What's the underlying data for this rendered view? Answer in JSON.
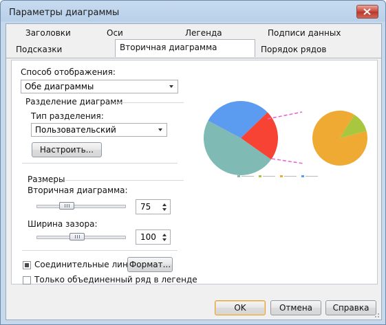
{
  "window": {
    "title": "Параметры диаграммы"
  },
  "tabs_row1": [
    "Заголовки",
    "Оси",
    "Легенда",
    "Подписи данных"
  ],
  "tabs_row2": [
    "Подсказки",
    "Вторичная диаграмма",
    "Порядок рядов"
  ],
  "active_tab": "Вторичная диаграмма",
  "display": {
    "label": "Способ отображения:",
    "value": "Обе диаграммы"
  },
  "split": {
    "group_label": "Разделение диаграмм",
    "type_label": "Тип разделения:",
    "type_value": "Пользовательский",
    "configure_button": "Настроить..."
  },
  "sizes": {
    "group_label": "Размеры",
    "secondary_label": "Вторичная диаграмма:",
    "secondary_value": "75",
    "secondary_level": 0.5,
    "gap_label": "Ширина зазора:",
    "gap_value": "100",
    "gap_level": 0.55
  },
  "connectors": {
    "label": "Соединительные линии",
    "checked": "partial",
    "format_button": "Формат..."
  },
  "legend_merged": {
    "label": "Только объединенный ряд в легенде",
    "checked": false
  },
  "footer": {
    "ok": "OK",
    "cancel": "Отмена",
    "help": "Справка"
  },
  "preview": {
    "primary_slices": [
      {
        "fraction": 0.3,
        "color": "#5b9bf0"
      },
      {
        "fraction": 0.22,
        "color": "#f64333"
      },
      {
        "fraction": 0.48,
        "color": "#7fbab4"
      }
    ],
    "secondary_slices": [
      {
        "fraction": 0.88,
        "color": "#eeaa33"
      },
      {
        "fraction": 0.12,
        "color": "#a9c63f"
      }
    ],
    "connector_color": "#e866d6",
    "legend_colors": [
      "#7fbab4",
      "#a9c63f",
      "#eeaa33",
      "#5b9bf0"
    ]
  }
}
